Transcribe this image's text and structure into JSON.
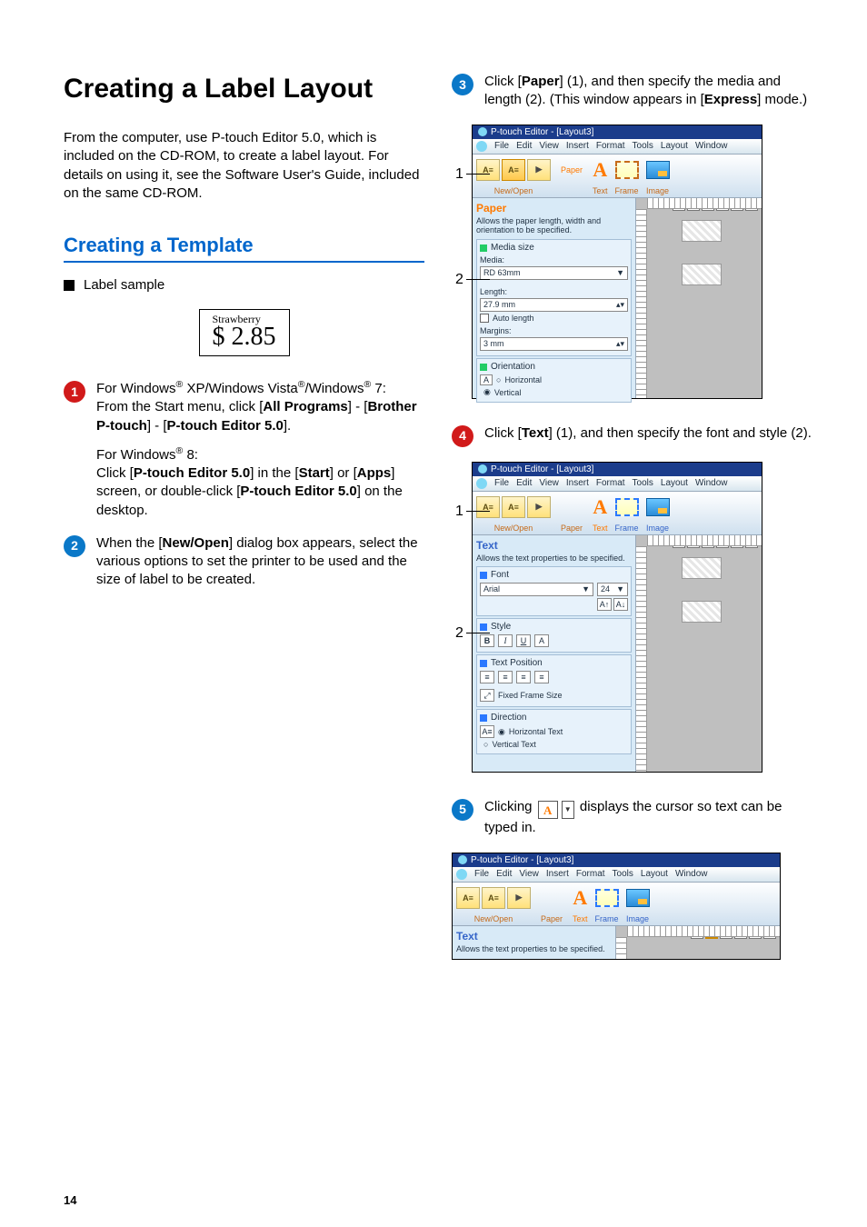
{
  "page_number": "14",
  "h1": "Creating a Label Layout",
  "intro": "From the computer, use P-touch Editor 5.0, which is included on the CD-ROM, to create a label layout. For details on using it, see the Software User's Guide, included on the same CD-ROM.",
  "h2": "Creating a Template",
  "subhead": "Label sample",
  "label_sample": {
    "top": "Strawberry",
    "main": "$ 2.85"
  },
  "steps": {
    "1": {
      "p1_pre": "For Windows",
      "p1_mid": " XP/Windows Vista",
      "p1_mid2": "/Windows",
      "p1_post": " 7:",
      "p1b_a": "From the Start menu, click [",
      "p1b_b": "All Programs",
      "p1b_c": "] - [",
      "p1b_d": "Brother P-touch",
      "p1b_e": "] - [",
      "p1b_f": "P-touch Editor 5.0",
      "p1b_g": "].",
      "p2_pre": "For Windows",
      "p2_post": " 8:",
      "p2b_a": "Click [",
      "p2b_b": "P-touch Editor 5.0",
      "p2b_c": "] in the [",
      "p2b_d": "Start",
      "p2b_e": "] or [",
      "p2b_f": "Apps",
      "p2b_g": "] screen, or double-click [",
      "p2b_h": "P-touch Editor 5.0",
      "p2b_i": "] on the desktop."
    },
    "2": {
      "a": "When the [",
      "b": "New/Open",
      "c": "] dialog box appears, select the various options to set the printer to be used and the size of label to be created."
    },
    "3": {
      "a": "Click [",
      "b": "Paper",
      "c": "] (1), and then specify the media and length (2). (This window appears in [",
      "d": "Express",
      "e": "] mode.)"
    },
    "4": {
      "a": "Click [",
      "b": "Text",
      "c": "] (1), and then specify the font and style (2)."
    },
    "5": {
      "a": "Clicking ",
      "b": " displays the cursor so text can be typed in."
    }
  },
  "sup": "®",
  "win": {
    "title": "P-touch Editor - [Layout3]",
    "menus": [
      "File",
      "Edit",
      "View",
      "Insert",
      "Format",
      "Tools",
      "Layout",
      "Window"
    ],
    "tools": {
      "newopen": "New/Open",
      "paper": "Paper",
      "text": "Text",
      "frame": "Frame",
      "image": "Image"
    },
    "paper_panel": {
      "title": "Paper",
      "sub": "Allows the paper length, width and orientation to be specified.",
      "mediasize": "Media size",
      "media": "Media:",
      "media_val": "RD 63mm",
      "length": "Length:",
      "length_val": "27.9 mm",
      "auto": "Auto length",
      "margins": "Margins:",
      "margins_val": "3 mm",
      "orient": "Orientation",
      "horiz": "Horizontal",
      "vert": "Vertical"
    },
    "text_panel": {
      "title": "Text",
      "sub": "Allows the text properties to be specified.",
      "font": "Font",
      "font_val": "Arial",
      "size_val": "24",
      "style": "Style",
      "pos": "Text Position",
      "fixed": "Fixed Frame Size",
      "dir": "Direction",
      "horiz": "Horizontal Text",
      "vert": "Vertical Text"
    }
  },
  "inline_icon": {
    "a": "A",
    "dd": "▼"
  },
  "chart_data": null
}
